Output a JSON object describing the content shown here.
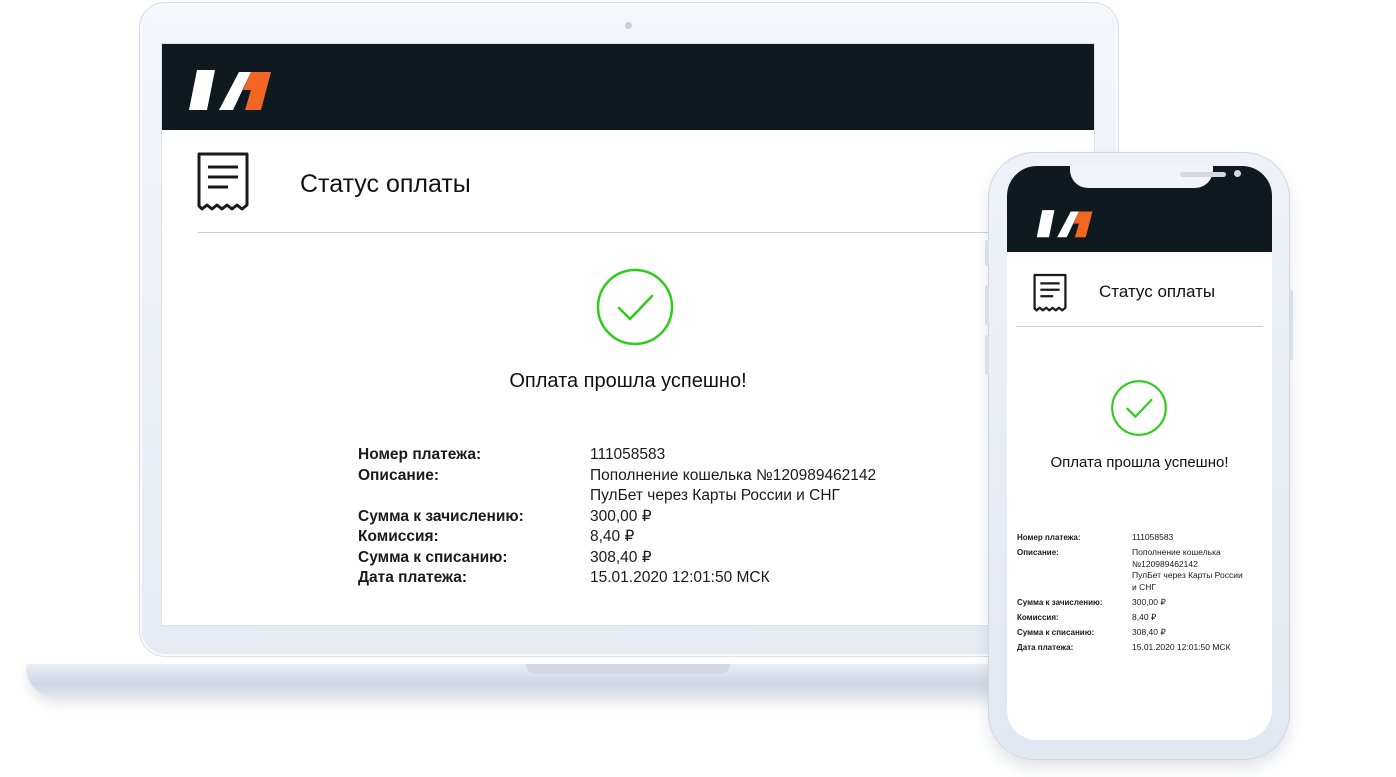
{
  "brand": {
    "logo_icon": "wm-logo-icon",
    "dark_color": "#0e1a20",
    "accent_color": "#f26522",
    "success_color": "#2ecc1a"
  },
  "page": {
    "title": "Статус оплаты",
    "receipt_icon": "receipt-icon",
    "status_icon": "check-circle-icon",
    "success_message": "Оплата прошла успешно!"
  },
  "details": {
    "payment_number": {
      "label": "Номер платежа:",
      "value": "111058583"
    },
    "description": {
      "label": "Описание:",
      "value_line1": "Пополнение кошелька №120989462142",
      "value_line2": "ПулБет через Карты России и СНГ"
    },
    "amount_credit": {
      "label": "Сумма к зачислению:",
      "value": "300,00 ₽"
    },
    "commission": {
      "label": "Комиссия:",
      "value": "8,40 ₽"
    },
    "amount_debit": {
      "label": "Сумма к списанию:",
      "value": "308,40 ₽"
    },
    "payment_date": {
      "label": "Дата платежа:",
      "value": "15.01.2020 12:01:50 МСК"
    }
  },
  "mobile_details": {
    "description_lines": [
      "Пополнение кошелька",
      "№120989462142",
      "ПулБет через Карты России",
      "и СНГ"
    ]
  }
}
